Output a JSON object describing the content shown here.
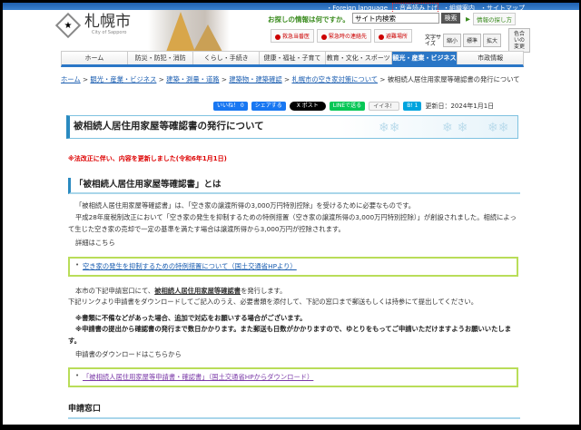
{
  "header": {
    "top_links": [
      "・Foreign language",
      "・音声読み上げ",
      "・組織案内",
      "・サイトマップ"
    ],
    "logo": {
      "name": "札幌市",
      "sub": "City of Sapporo"
    },
    "search": {
      "label": "お探しの情報は何ですか。",
      "value": "サイト内検索",
      "button": "検索",
      "howto": "情報の探し方"
    },
    "emergency": [
      "救急当番医",
      "緊急時の連絡先",
      "避難場所"
    ],
    "font_size": {
      "label": "文字サイズ",
      "options": [
        "縮小",
        "標準",
        "拡大"
      ],
      "color": "色合いの変更"
    }
  },
  "nav": {
    "items": [
      "ホーム",
      "防災・防犯・消防",
      "くらし・手続き",
      "健康・福祉・子育て",
      "教育・文化・スポーツ",
      "観光・産業・ビジネス",
      "市政情報"
    ],
    "active": 5
  },
  "breadcrumb": {
    "links": [
      "ホーム",
      "観光・産業・ビジネス",
      "建築・測量・道路",
      "建築物・建築確認",
      "札幌市の空き家対策について"
    ],
    "current": "被相続人居住用家屋等確認書の発行について"
  },
  "social": {
    "like": "いいね！ 0",
    "share": "シェアする",
    "post": "X ポスト",
    "line": "LINEで送る",
    "iine": "イイネ！",
    "hatena": "B! 1",
    "updated": "更新日：2024年1月1日"
  },
  "page_title": "被相続人居住用家屋等確認書の発行について",
  "note": "※法改正に伴い、内容を更新しました(令和6年1月1日)",
  "section1": {
    "heading": "「被相続人居住用家屋等確認書」とは",
    "p1": "「被相続人居住用家屋等確認書」は、「空き家の譲渡所得の3,000万円特別控除」を受けるために必要なものです。",
    "p2": "平成28年度税制改正において「空き家の発生を抑制するための特例措置（空き家の譲渡所得の3,000万円特別控除）」が創設されました。相続によって生じた空き家の売却で一定の基準を満たす場合は譲渡所得から3,000万円が控除されます。",
    "detail": "詳細はこちら",
    "link": "空き家の発生を抑制するための特例措置について（国土交通省HPより）",
    "p3_pre": "本市の下記申請窓口にて、",
    "p3_bold": "被相続人居住用家屋等確認書",
    "p3_post": "を発行します。",
    "p4": "下記リンクより申請書をダウンロードしてご記入のうえ、必要書類を添付して、下記の窓口まで郵送もしくは持参にて提出してください。",
    "n1": "※書類に不備などがあった場合、追加で対応をお願いする場合がございます。",
    "n2": "※申請書の提出から確認書の発行まで数日かかります。また郵送も日数がかかりますので、ゆとりをもってご申請いただけますようお願いいたします。",
    "download": "申請書のダウンロードはこちらから",
    "download_link": "「被相続人居住用家屋等申請書・確認書」（国土交通省HPからダウンロード）"
  },
  "section2": {
    "heading": "申請窓口"
  }
}
